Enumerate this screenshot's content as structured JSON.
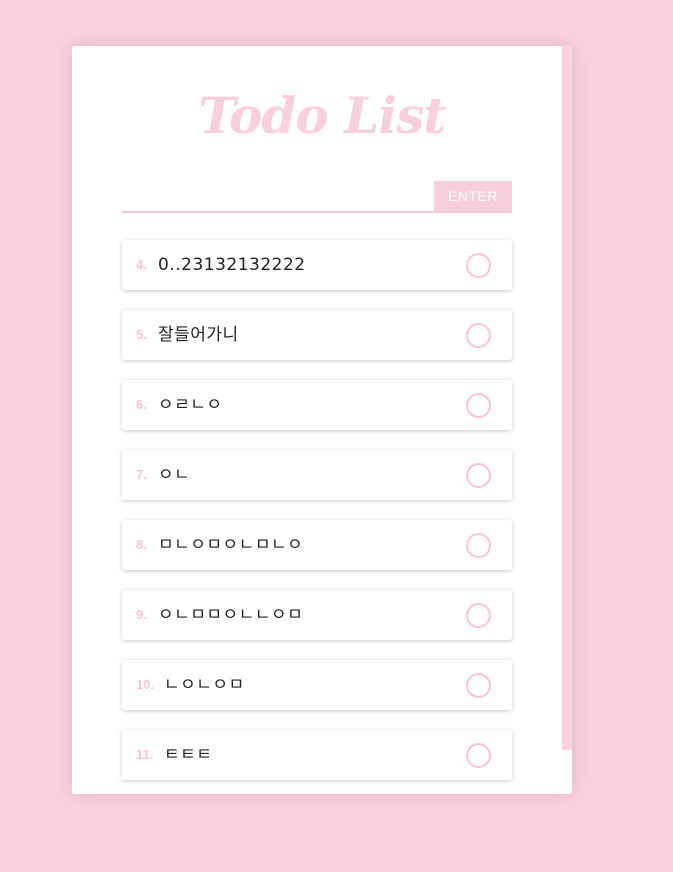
{
  "app": {
    "title": "Todo List"
  },
  "form": {
    "input_value": "",
    "enter_label": "ENTER"
  },
  "todos": [
    {
      "num": "4.",
      "text": "0..23132132222"
    },
    {
      "num": "5.",
      "text": "잘들어가니"
    },
    {
      "num": "6.",
      "text": "ㅇㄹㄴㅇ"
    },
    {
      "num": "7.",
      "text": "ㅇㄴ"
    },
    {
      "num": "8.",
      "text": "ㅁㄴㅇㅁㅇㄴㅁㄴㅇ"
    },
    {
      "num": "9.",
      "text": "ㅇㄴㅁㅁㅇㄴㄴㅇㅁ"
    },
    {
      "num": "10.",
      "text": "ㄴㅇㄴㅇㅁ"
    },
    {
      "num": "11.",
      "text": "ㅌㅌㅌ"
    }
  ],
  "colors": {
    "background": "#f7d3df",
    "accent": "#f7cfdc",
    "card": "#ffffff"
  }
}
